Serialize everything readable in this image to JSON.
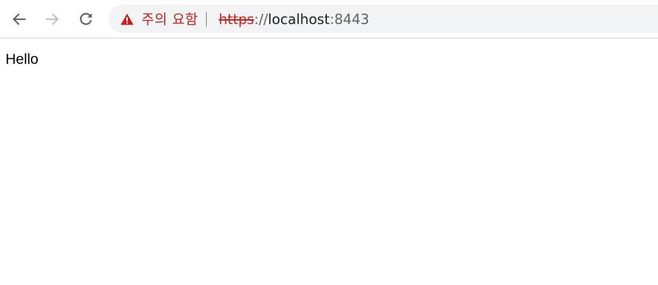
{
  "browser": {
    "nav": {
      "back_icon": "arrow-left-icon",
      "forward_icon": "arrow-right-icon",
      "reload_icon": "reload-icon",
      "forward_enabled": false
    },
    "omnibox": {
      "security_icon": "warning-triangle-icon",
      "security_label": "주의 요함",
      "url_scheme": "https",
      "url_separator": "://",
      "url_host": "localhost",
      "url_port": ":8443"
    },
    "colors": {
      "warning": "#c5221f",
      "omnibox_bg": "#f1f3f4",
      "icon_active": "#5f6368",
      "icon_disabled": "#bdc1c6"
    }
  },
  "page": {
    "text": "Hello"
  }
}
